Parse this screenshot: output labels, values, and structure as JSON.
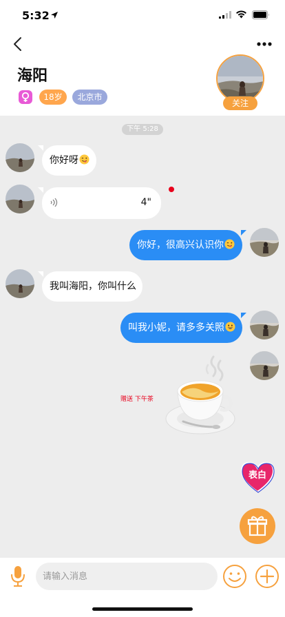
{
  "status_bar": {
    "time": "5:32"
  },
  "header": {
    "name": "海阳",
    "age_tag": "18岁",
    "city_tag": "北京市",
    "follow_label": "关注",
    "gender": "female"
  },
  "chat": {
    "timestamp": "下午 5:28",
    "messages": [
      {
        "side": "in",
        "type": "text",
        "text": "你好呀",
        "emoji": "winking-tongue-emoji"
      },
      {
        "side": "in",
        "type": "voice",
        "duration": "4\"",
        "unread": true
      },
      {
        "side": "out",
        "type": "text",
        "text": "你好，很高兴认识你",
        "emoji": "winking-tongue-emoji"
      },
      {
        "side": "in",
        "type": "text",
        "text": "我叫海阳，你叫什么"
      },
      {
        "side": "out",
        "type": "text",
        "text": "叫我小妮，请多多关照",
        "emoji": "grinning-emoji"
      },
      {
        "side": "out",
        "type": "gift",
        "gift_label": "赠送 下午茶"
      }
    ],
    "confess_label": "表白"
  },
  "input_bar": {
    "placeholder": "请输入消息"
  },
  "colors": {
    "accent": "#f6a13e",
    "outgoing_bubble": "#2a8df5",
    "chat_bg": "#ededed",
    "unread_dot": "#e8001c",
    "age_tag": "#ffa64d",
    "city_tag": "#9aa8dc"
  }
}
